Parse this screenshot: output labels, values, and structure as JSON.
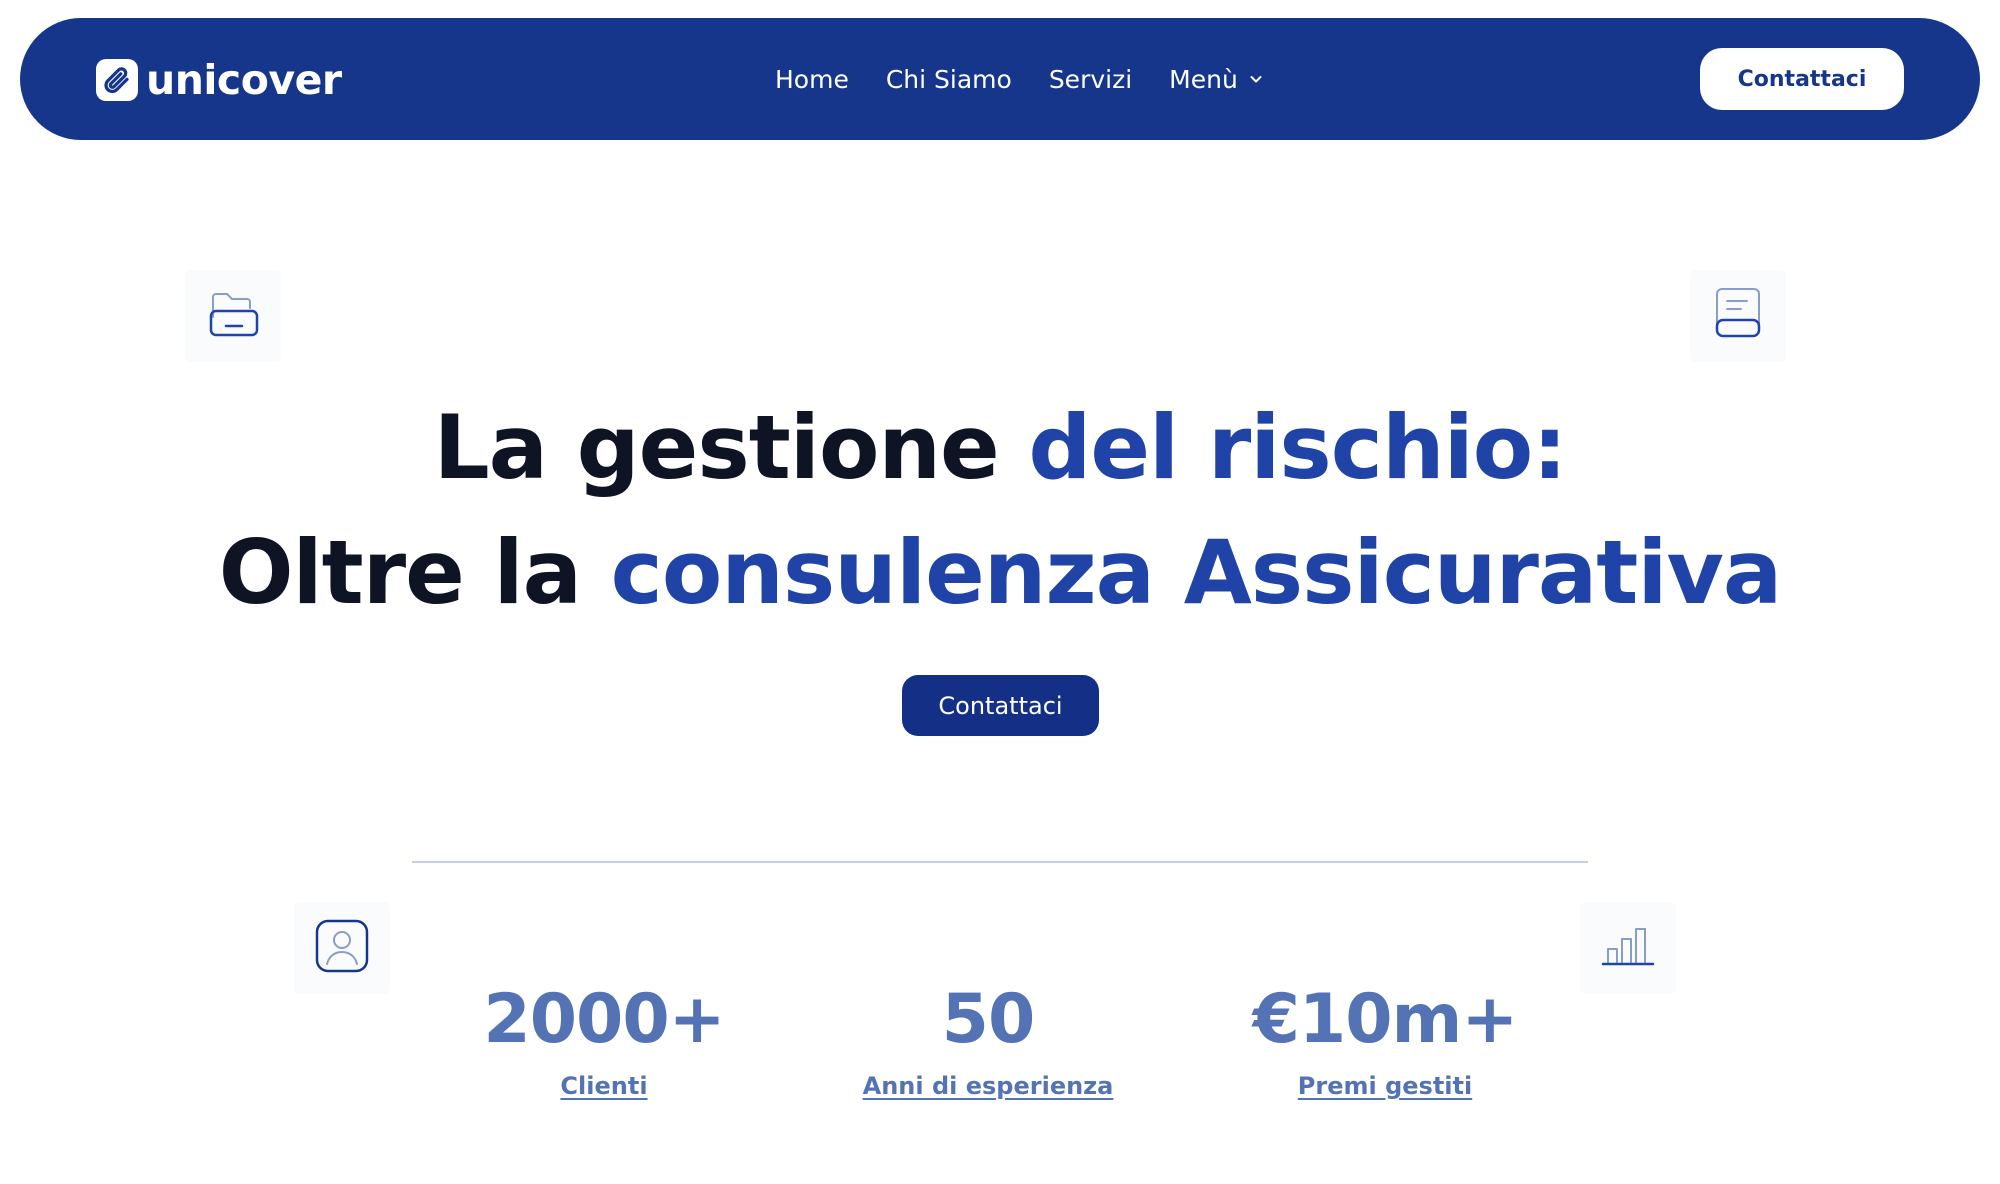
{
  "navbar": {
    "brand": "unicover",
    "links": [
      {
        "label": "Home"
      },
      {
        "label": "Chi Siamo"
      },
      {
        "label": "Servizi"
      },
      {
        "label": "Menù"
      }
    ],
    "cta": "Contattaci"
  },
  "hero": {
    "line1_dark": "La gestione ",
    "line1_accent": "del rischio:",
    "line2_dark": "Oltre la ",
    "line2_accent": "consulenza Assicurativa",
    "cta": "Contattaci"
  },
  "stats": [
    {
      "value": "2000+",
      "label": "Clienti"
    },
    {
      "value": "50",
      "label": "Anni di esperienza"
    },
    {
      "value": "€10m+",
      "label": "Premi gestiti"
    }
  ],
  "icons": {
    "brand": "paperclip-icon",
    "menu_chevron": "chevron-down-icon",
    "top_left": "folder-icon",
    "top_right": "document-icon",
    "bottom_left": "user-profile-icon",
    "bottom_right": "bar-chart-icon"
  },
  "colors": {
    "nav_bg": "#15368b",
    "accent": "#2043a8",
    "stat": "#5473b5",
    "dark_text": "#0f1424"
  }
}
